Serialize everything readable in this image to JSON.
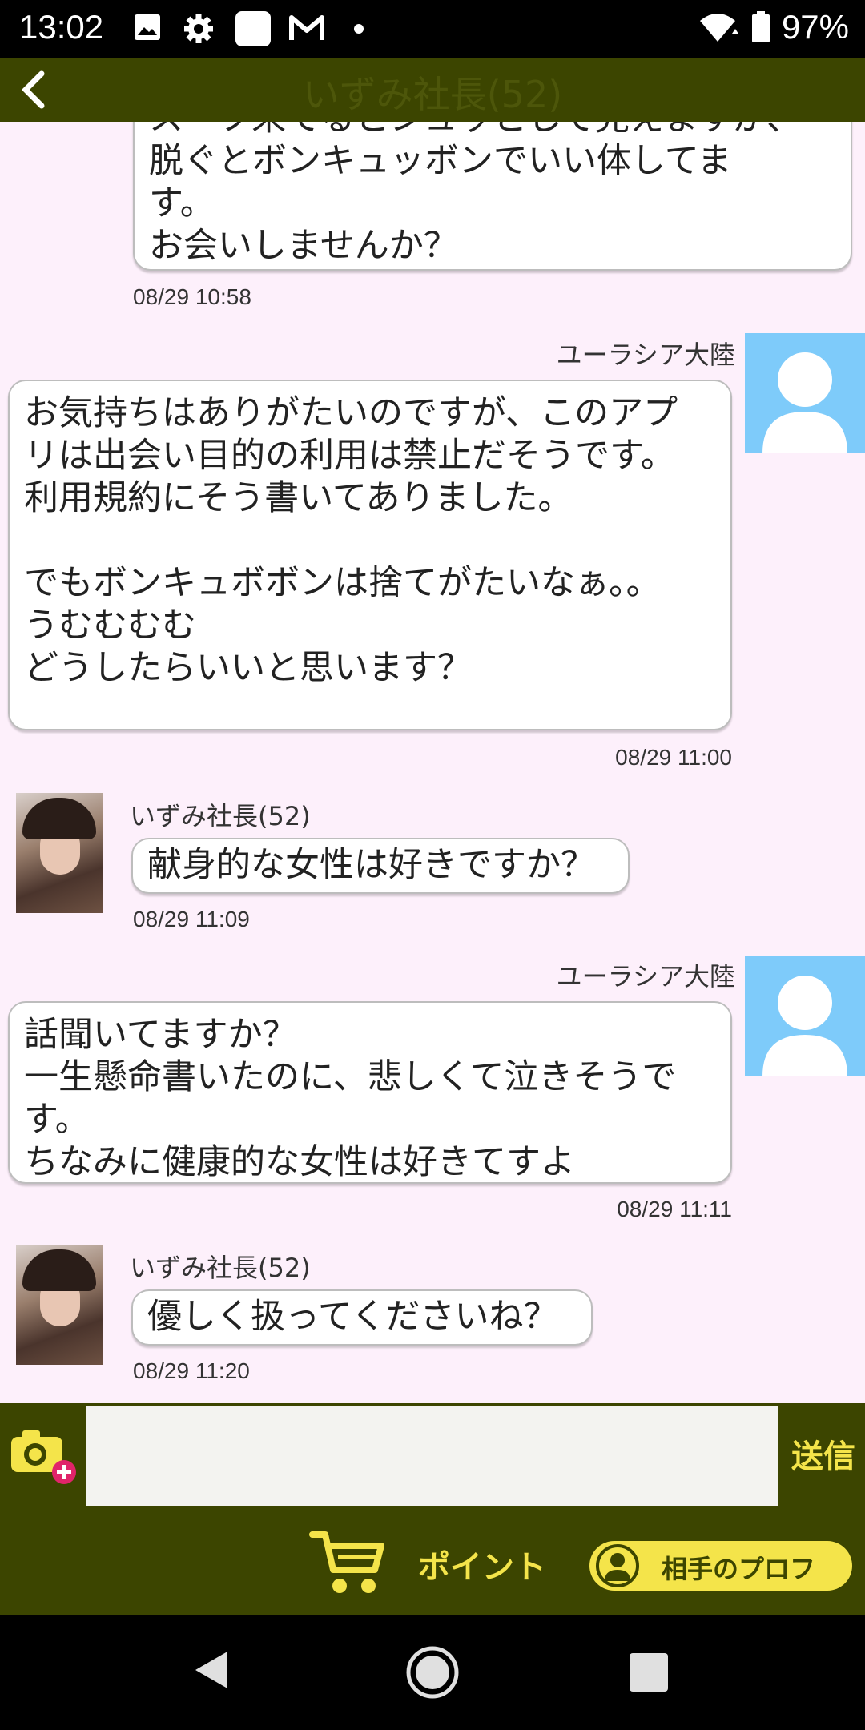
{
  "status_bar": {
    "time": "13:02",
    "battery": "97%"
  },
  "header": {
    "title": "いずみ社長(52)"
  },
  "messages": [
    {
      "side": "left",
      "sender": "",
      "text": "スーツ来てるとシュッとして見えますが、\n脱ぐとボンキュッボンでいい体してま\nす。\nお会いしませんか？",
      "timestamp": "08/29 10:58"
    },
    {
      "side": "right",
      "sender": "ユーラシア大陸",
      "text": "お気持ちはありがたいのですが、このアプ\nリは出会い目的の利用は禁止だそうです。\n利用規約にそう書いてありました。\n\nでもボンキュボボンは捨てがたいなぁ。。\nうむむむむ\nどうしたらいいと思います？",
      "timestamp": "08/29 11:00"
    },
    {
      "side": "left",
      "sender": "いずみ社長(52)",
      "text": "献身的な女性は好きですか？",
      "timestamp": "08/29 11:09"
    },
    {
      "side": "right",
      "sender": "ユーラシア大陸",
      "text": "話聞いてますか？\n一生懸命書いたのに、悲しくて泣きそうで\nす。\nちなみに健康的な女性は好きてすよ",
      "timestamp": "08/29 11:11"
    },
    {
      "side": "left",
      "sender": "いずみ社長(52)",
      "text": "優しく扱ってくださいね？",
      "timestamp": "08/29 11:20"
    }
  ],
  "composer": {
    "input_value": "",
    "send_label": "送信",
    "points_label": "ポイント",
    "profile_label": "相手のプロフ"
  },
  "colors": {
    "brand": "#3c4500",
    "accent": "#f4e44a",
    "chat_bg": "#fdf0fb",
    "avatar_blue": "#7ecbfa"
  },
  "icons": [
    "back-icon",
    "image-icon",
    "settings-icon",
    "app-icon",
    "gmail-icon",
    "wifi-icon",
    "battery-icon",
    "camera-add-icon",
    "cart-icon",
    "person-icon",
    "nav-back-icon",
    "nav-home-icon",
    "nav-recents-icon"
  ]
}
